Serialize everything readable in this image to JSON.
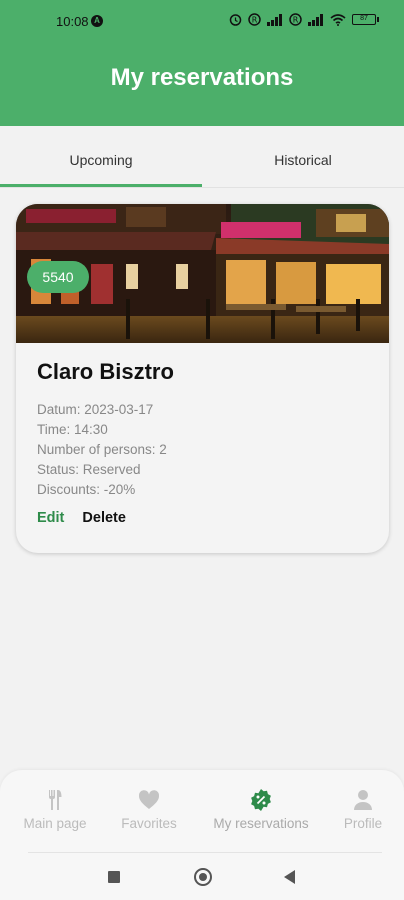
{
  "status_bar": {
    "time": "10:08",
    "battery": "87"
  },
  "header": {
    "title": "My reservations"
  },
  "tabs": [
    {
      "label": "Upcoming",
      "active": true
    },
    {
      "label": "Historical",
      "active": false
    }
  ],
  "reservation": {
    "code": "5540",
    "restaurant_name": "Claro Bisztro",
    "details": [
      "Datum: 2023-03-17",
      "Time: 14:30",
      "Number of persons: 2",
      "Status: Reserved",
      "Discounts: -20%"
    ],
    "edit_label": "Edit",
    "delete_label": "Delete"
  },
  "bottom_nav": {
    "items": [
      {
        "label": "Main page",
        "icon": "cutlery-icon"
      },
      {
        "label": "Favorites",
        "icon": "heart-icon"
      },
      {
        "label": "My reservations",
        "icon": "percent-badge-icon",
        "active": true
      },
      {
        "label": "Profile",
        "icon": "person-icon"
      }
    ]
  },
  "colors": {
    "accent": "#4caf6a",
    "edit": "#2e8b4a"
  }
}
